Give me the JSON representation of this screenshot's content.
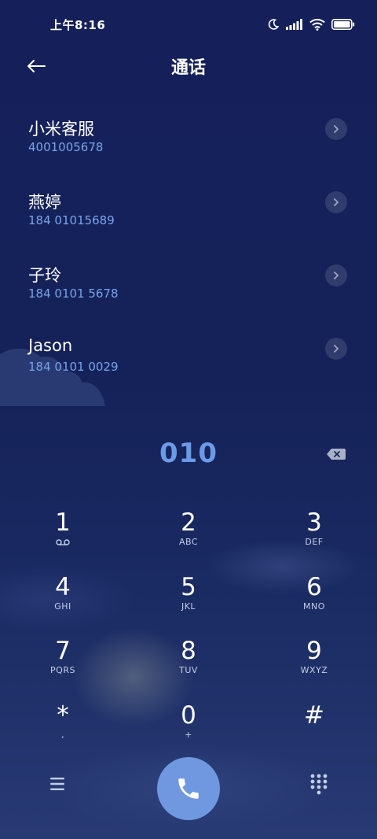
{
  "status_bar": {
    "time": "上午8:16",
    "icons": [
      "moon-icon",
      "signal-icon",
      "wifi-icon",
      "battery-icon"
    ]
  },
  "header": {
    "title": "通话",
    "back_icon": "arrow-left-icon"
  },
  "contacts": [
    {
      "name": "小米客服",
      "number": "4001005678"
    },
    {
      "name": "燕婷",
      "number": "184 01015689"
    },
    {
      "name": "子玲",
      "number": "184 0101 5678"
    },
    {
      "name": "Jason",
      "number": "184 0101 0029"
    }
  ],
  "dialer": {
    "number": "010",
    "backspace_icon": "backspace-icon"
  },
  "keypad": {
    "keys": [
      {
        "digit": "1",
        "letters": "",
        "sub_icon": "voicemail-icon"
      },
      {
        "digit": "2",
        "letters": "ABC"
      },
      {
        "digit": "3",
        "letters": "DEF"
      },
      {
        "digit": "4",
        "letters": "GHI"
      },
      {
        "digit": "5",
        "letters": "JKL"
      },
      {
        "digit": "6",
        "letters": "MNO"
      },
      {
        "digit": "7",
        "letters": "PQRS"
      },
      {
        "digit": "8",
        "letters": "TUV"
      },
      {
        "digit": "9",
        "letters": "WXYZ"
      },
      {
        "digit": "*",
        "letters": ","
      },
      {
        "digit": "0",
        "letters": "+"
      },
      {
        "digit": "#",
        "letters": ""
      }
    ]
  },
  "bottom_bar": {
    "menu_icon": "menu-icon",
    "call_icon": "phone-icon",
    "keypad_icon": "dialpad-icon"
  },
  "colors": {
    "background": "#152259",
    "accent": "#6b9ae8",
    "number_text": "#79a4ea",
    "call_button": "#6f98e0"
  }
}
